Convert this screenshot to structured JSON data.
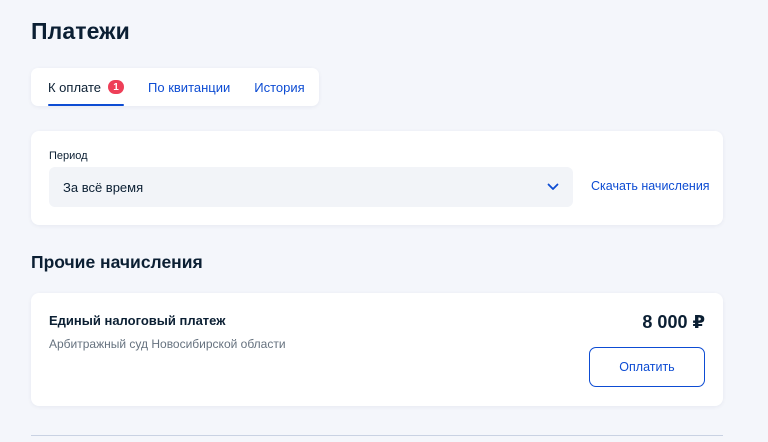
{
  "page": {
    "title": "Платежи"
  },
  "tabs": [
    {
      "label": "К оплате",
      "badge": "1",
      "active": true
    },
    {
      "label": "По квитанции",
      "active": false
    },
    {
      "label": "История",
      "active": false
    }
  ],
  "period": {
    "label": "Период",
    "selected": "За всё время",
    "download_link": "Скачать начисления"
  },
  "other_charges": {
    "title": "Прочие начисления",
    "items": [
      {
        "title": "Единый налоговый платеж",
        "subtitle": "Арбитражный суд Новосибирской области",
        "amount": "8 000 ₽",
        "pay_label": "Оплатить"
      }
    ]
  },
  "icons": {
    "select_chevron": "chevron-down-icon"
  },
  "colors": {
    "accent": "#0d4cd3",
    "badge": "#ee3f58",
    "background": "#f4f6fb",
    "text": "#0b1f33",
    "muted": "#66727f"
  }
}
